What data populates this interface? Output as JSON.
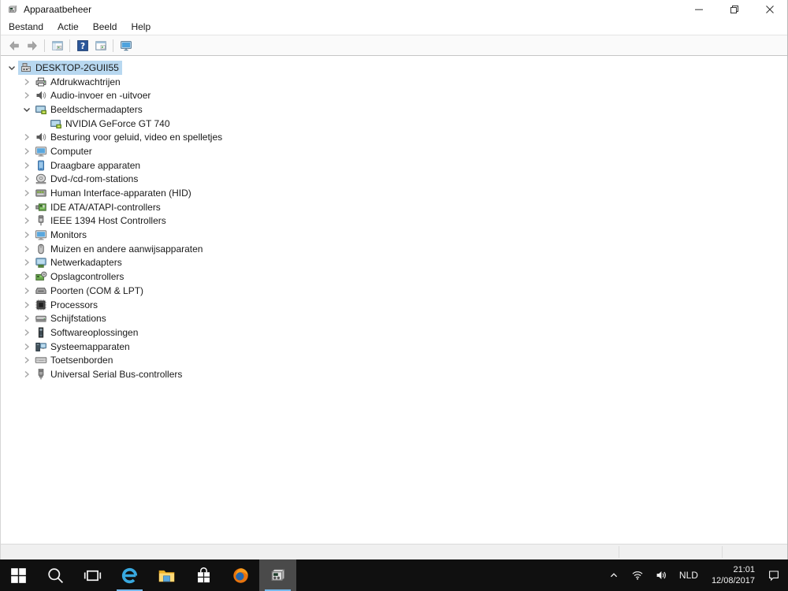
{
  "window": {
    "title": "Apparaatbeheer",
    "icon": "device-manager-icon"
  },
  "menu": {
    "items": [
      "Bestand",
      "Actie",
      "Beeld",
      "Help"
    ]
  },
  "toolbar": {
    "buttons": [
      {
        "name": "back-button",
        "icon": "back-icon"
      },
      {
        "name": "forward-button",
        "icon": "forward-icon"
      },
      {
        "sep": true
      },
      {
        "name": "show-hide-console-tree-button",
        "icon": "console-tree-icon"
      },
      {
        "sep": true
      },
      {
        "name": "help-button",
        "icon": "help-icon"
      },
      {
        "name": "properties-button",
        "icon": "properties-icon"
      },
      {
        "sep": true
      },
      {
        "name": "scan-hardware-changes-button",
        "icon": "scan-hardware-icon"
      }
    ]
  },
  "tree": {
    "items": [
      {
        "label": "DESKTOP-2GUII55",
        "level": 0,
        "state": "expanded",
        "icon": "computer-icon",
        "selected": true
      },
      {
        "label": "Afdrukwachtrijen",
        "level": 1,
        "state": "collapsed",
        "icon": "printer-icon"
      },
      {
        "label": "Audio-invoer en -uitvoer",
        "level": 1,
        "state": "collapsed",
        "icon": "speaker-icon"
      },
      {
        "label": "Beeldschermadapters",
        "level": 1,
        "state": "expanded",
        "icon": "display-adapter-icon"
      },
      {
        "label": "NVIDIA GeForce GT 740",
        "level": 2,
        "state": "leaf",
        "icon": "display-adapter-icon"
      },
      {
        "label": "Besturing voor geluid, video en spelletjes",
        "level": 1,
        "state": "collapsed",
        "icon": "speaker-icon"
      },
      {
        "label": "Computer",
        "level": 1,
        "state": "collapsed",
        "icon": "monitor-icon"
      },
      {
        "label": "Draagbare apparaten",
        "level": 1,
        "state": "collapsed",
        "icon": "portable-device-icon"
      },
      {
        "label": "Dvd-/cd-rom-stations",
        "level": 1,
        "state": "collapsed",
        "icon": "disc-drive-icon"
      },
      {
        "label": "Human Interface-apparaten (HID)",
        "level": 1,
        "state": "collapsed",
        "icon": "hid-icon"
      },
      {
        "label": "IDE ATA/ATAPI-controllers",
        "level": 1,
        "state": "collapsed",
        "icon": "ide-controller-icon"
      },
      {
        "label": "IEEE 1394 Host Controllers",
        "level": 1,
        "state": "collapsed",
        "icon": "ieee1394-icon"
      },
      {
        "label": "Monitors",
        "level": 1,
        "state": "collapsed",
        "icon": "monitor-icon"
      },
      {
        "label": "Muizen en andere aanwijsapparaten",
        "level": 1,
        "state": "collapsed",
        "icon": "mouse-icon"
      },
      {
        "label": "Netwerkadapters",
        "level": 1,
        "state": "collapsed",
        "icon": "network-adapter-icon"
      },
      {
        "label": "Opslagcontrollers",
        "level": 1,
        "state": "collapsed",
        "icon": "storage-controller-icon"
      },
      {
        "label": "Poorten (COM & LPT)",
        "level": 1,
        "state": "collapsed",
        "icon": "port-icon"
      },
      {
        "label": "Processors",
        "level": 1,
        "state": "collapsed",
        "icon": "processor-icon"
      },
      {
        "label": "Schijfstations",
        "level": 1,
        "state": "collapsed",
        "icon": "disk-drive-icon"
      },
      {
        "label": "Softwareoplossingen",
        "level": 1,
        "state": "collapsed",
        "icon": "software-icon"
      },
      {
        "label": "Systeemapparaten",
        "level": 1,
        "state": "collapsed",
        "icon": "system-device-icon"
      },
      {
        "label": "Toetsenborden",
        "level": 1,
        "state": "collapsed",
        "icon": "keyboard-icon"
      },
      {
        "label": "Universal Serial Bus-controllers",
        "level": 1,
        "state": "collapsed",
        "icon": "usb-icon"
      }
    ]
  },
  "taskbar": {
    "buttons": [
      {
        "name": "start-button",
        "icon": "start-icon"
      },
      {
        "name": "search-button",
        "icon": "search-icon"
      },
      {
        "name": "task-view-button",
        "icon": "task-view-icon"
      },
      {
        "name": "edge-button",
        "icon": "edge-icon",
        "open": true
      },
      {
        "name": "file-explorer-button",
        "icon": "file-explorer-icon"
      },
      {
        "name": "store-button",
        "icon": "store-icon"
      },
      {
        "name": "firefox-button",
        "icon": "firefox-icon"
      },
      {
        "name": "device-manager-button",
        "icon": "device-manager-icon",
        "open": true,
        "active": true
      }
    ],
    "tray": {
      "language": "NLD",
      "time": "21:01",
      "date": "12/08/2017"
    }
  },
  "colors": {
    "selection": "#b8d8f0",
    "taskbar_bg": "#101010",
    "active_app_bg": "#4a4a4a",
    "open_indicator": "#76b9ed",
    "accent": "#0078d7"
  }
}
